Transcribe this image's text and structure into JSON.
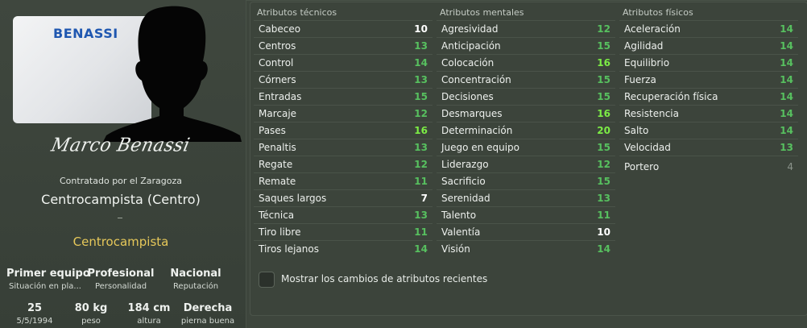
{
  "profile": {
    "kit_name": "BENASSI",
    "signature": "Marco Benassi",
    "signed_by": "Contratado por el Zaragoza",
    "position_title": "Centrocampista (Centro)",
    "dash": "-",
    "role": "Centrocampista",
    "status": [
      {
        "value": "Primer equipo",
        "label": "Situación en pla..."
      },
      {
        "value": "Profesional",
        "label": "Personalidad"
      },
      {
        "value": "Nacional",
        "label": "Reputación"
      }
    ],
    "physical": [
      {
        "value": "25",
        "label": "5/5/1994"
      },
      {
        "value": "80 kg",
        "label": "peso"
      },
      {
        "value": "184 cm",
        "label": "altura"
      },
      {
        "value": "Derecha",
        "label": "pierna buena"
      }
    ]
  },
  "attributes": {
    "technical": {
      "title": "Atributos técnicos",
      "items": [
        {
          "name": "Cabeceo",
          "value": "10"
        },
        {
          "name": "Centros",
          "value": "13"
        },
        {
          "name": "Control",
          "value": "14"
        },
        {
          "name": "Córners",
          "value": "13"
        },
        {
          "name": "Entradas",
          "value": "15"
        },
        {
          "name": "Marcaje",
          "value": "12"
        },
        {
          "name": "Pases",
          "value": "16"
        },
        {
          "name": "Penaltis",
          "value": "13"
        },
        {
          "name": "Regate",
          "value": "12"
        },
        {
          "name": "Remate",
          "value": "11"
        },
        {
          "name": "Saques largos",
          "value": "7"
        },
        {
          "name": "Técnica",
          "value": "13"
        },
        {
          "name": "Tiro libre",
          "value": "11"
        },
        {
          "name": "Tiros lejanos",
          "value": "14"
        }
      ]
    },
    "mental": {
      "title": "Atributos mentales",
      "items": [
        {
          "name": "Agresividad",
          "value": "12"
        },
        {
          "name": "Anticipación",
          "value": "15"
        },
        {
          "name": "Colocación",
          "value": "16"
        },
        {
          "name": "Concentración",
          "value": "15"
        },
        {
          "name": "Decisiones",
          "value": "15"
        },
        {
          "name": "Desmarques",
          "value": "16"
        },
        {
          "name": "Determinación",
          "value": "20"
        },
        {
          "name": "Juego en equipo",
          "value": "15"
        },
        {
          "name": "Liderazgo",
          "value": "12"
        },
        {
          "name": "Sacrificio",
          "value": "15"
        },
        {
          "name": "Serenidad",
          "value": "13"
        },
        {
          "name": "Talento",
          "value": "11"
        },
        {
          "name": "Valentía",
          "value": "10"
        },
        {
          "name": "Visión",
          "value": "14"
        }
      ]
    },
    "physical": {
      "title": "Atributos físicos",
      "items": [
        {
          "name": "Aceleración",
          "value": "14"
        },
        {
          "name": "Agilidad",
          "value": "14"
        },
        {
          "name": "Equilibrio",
          "value": "14"
        },
        {
          "name": "Fuerza",
          "value": "14"
        },
        {
          "name": "Recuperación física",
          "value": "14"
        },
        {
          "name": "Resistencia",
          "value": "14"
        },
        {
          "name": "Salto",
          "value": "14"
        },
        {
          "name": "Velocidad",
          "value": "13"
        }
      ],
      "goalkeeper": {
        "name": "Portero",
        "value": "4"
      }
    }
  },
  "options": {
    "show_recent_changes_label": "Mostrar los cambios de atributos recientes",
    "show_recent_changes_checked": false
  },
  "colors": {
    "attr_good": "#57c05f",
    "attr_very_good": "#7cec45",
    "attr_normal": "#ffffff",
    "attr_minor": "#8b938b",
    "role": "#e6c85a",
    "kit_text": "#1f57b0"
  }
}
